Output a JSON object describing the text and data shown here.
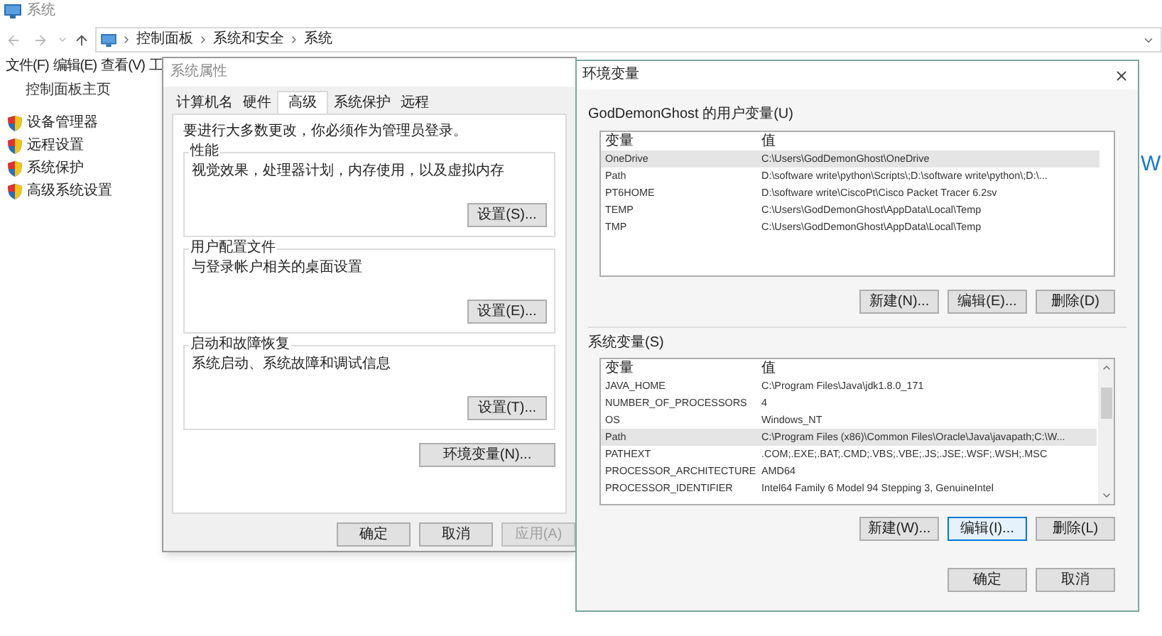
{
  "explorer": {
    "title": "系统",
    "breadcrumb": [
      "控制面板",
      "系统和安全",
      "系统"
    ],
    "menu": [
      "文件(F)",
      "编辑(E)",
      "查看(V)",
      "工"
    ],
    "sidebar_home": "控制面板主页",
    "sidebar_items": [
      "设备管理器",
      "远程设置",
      "系统保护",
      "高级系统设置"
    ],
    "content_fragment": "W"
  },
  "system_properties": {
    "title": "系统属性",
    "tabs": [
      {
        "label": "计算机名",
        "selected": false
      },
      {
        "label": "硬件",
        "selected": false
      },
      {
        "label": "高级",
        "selected": true
      },
      {
        "label": "系统保护",
        "selected": false
      },
      {
        "label": "远程",
        "selected": false
      }
    ],
    "admin_note": "要进行大多数更改，你必须作为管理员登录。",
    "groups": [
      {
        "title": "性能",
        "description": "视觉效果，处理器计划，内存使用，以及虚拟内存",
        "button": "设置(S)..."
      },
      {
        "title": "用户配置文件",
        "description": "与登录帐户相关的桌面设置",
        "button": "设置(E)..."
      },
      {
        "title": "启动和故障恢复",
        "description": "系统启动、系统故障和调试信息",
        "button": "设置(T)..."
      }
    ],
    "env_button": "环境变量(N)...",
    "buttons": [
      {
        "label": "确定",
        "disabled": false
      },
      {
        "label": "取消",
        "disabled": false
      },
      {
        "label": "应用(A)",
        "disabled": true
      }
    ]
  },
  "environment_variables": {
    "title": "环境变量",
    "user_label": "GodDemonGhost 的用户变量(U)",
    "user_columns": [
      "变量",
      "值"
    ],
    "user_rows": [
      {
        "name": "OneDrive",
        "value": "C:\\Users\\GodDemonGhost\\OneDrive",
        "selected": true
      },
      {
        "name": "Path",
        "value": "D:\\software write\\python\\Scripts\\;D:\\software write\\python\\;D:\\...",
        "selected": false
      },
      {
        "name": "PT6HOME",
        "value": "D:\\software write\\CiscoPt\\Cisco Packet Tracer 6.2sv",
        "selected": false
      },
      {
        "name": "TEMP",
        "value": "C:\\Users\\GodDemonGhost\\AppData\\Local\\Temp",
        "selected": false
      },
      {
        "name": "TMP",
        "value": "C:\\Users\\GodDemonGhost\\AppData\\Local\\Temp",
        "selected": false
      }
    ],
    "user_buttons": [
      {
        "label": "新建(N)...",
        "focused": false
      },
      {
        "label": "编辑(E)...",
        "focused": false
      },
      {
        "label": "删除(D)",
        "focused": false
      }
    ],
    "system_label": "系统变量(S)",
    "system_columns": [
      "变量",
      "值"
    ],
    "system_rows": [
      {
        "name": "JAVA_HOME",
        "value": "C:\\Program Files\\Java\\jdk1.8.0_171",
        "selected": false
      },
      {
        "name": "NUMBER_OF_PROCESSORS",
        "value": "4",
        "selected": false
      },
      {
        "name": "OS",
        "value": "Windows_NT",
        "selected": false
      },
      {
        "name": "Path",
        "value": "C:\\Program Files (x86)\\Common Files\\Oracle\\Java\\javapath;C:\\W...",
        "selected": true
      },
      {
        "name": "PATHEXT",
        "value": ".COM;.EXE;.BAT;.CMD;.VBS;.VBE;.JS;.JSE;.WSF;.WSH;.MSC",
        "selected": false
      },
      {
        "name": "PROCESSOR_ARCHITECTURE",
        "value": "AMD64",
        "selected": false
      },
      {
        "name": "PROCESSOR_IDENTIFIER",
        "value": "Intel64 Family 6 Model 94 Stepping 3, GenuineIntel",
        "selected": false
      }
    ],
    "system_buttons": [
      {
        "label": "新建(W)...",
        "focused": false
      },
      {
        "label": "编辑(I)...",
        "focused": true
      },
      {
        "label": "删除(L)",
        "focused": false
      }
    ],
    "buttons": [
      {
        "label": "确定",
        "focused": false
      },
      {
        "label": "取消",
        "focused": false
      }
    ]
  }
}
